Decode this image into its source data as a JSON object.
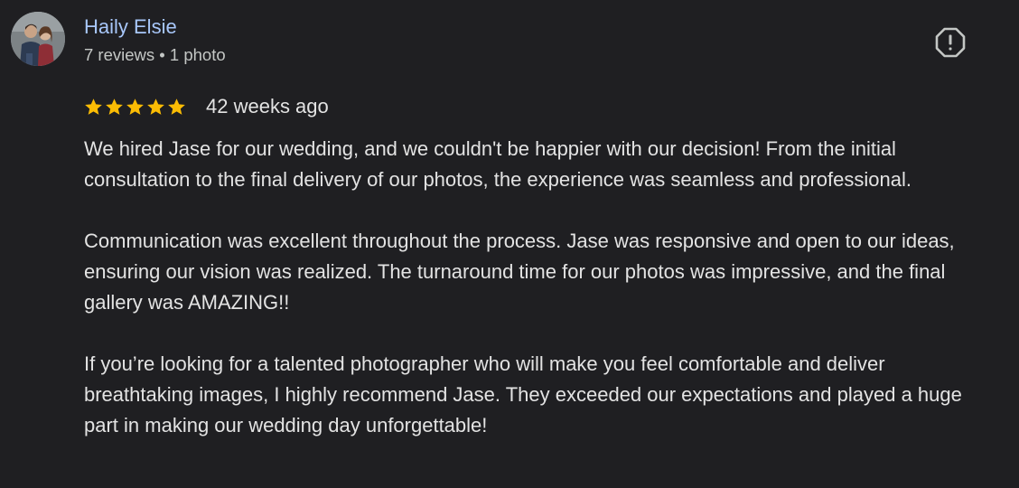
{
  "reviewer": {
    "name": "Haily Elsie",
    "meta": "7 reviews • 1 photo"
  },
  "report_icon": "report-flag-icon",
  "rating": {
    "stars": 5,
    "max_stars": 5,
    "date": "42 weeks ago",
    "star_color": "#fbbc04"
  },
  "review": {
    "paragraphs": [
      "We hired Jase for our wedding, and we couldn't be happier with our decision! From the initial consultation to the final delivery of our photos, the experience was seamless and professional.",
      "Communication was excellent throughout the process. Jase was responsive and open to our ideas, ensuring our vision was realized. The turnaround time for our photos was impressive, and the final gallery was AMAZING!!",
      "If you’re looking for a talented photographer who will make you feel comfortable and deliver breathtaking images, I highly recommend Jase. They exceeded our expectations and played a huge part in making our wedding day unforgettable!"
    ]
  },
  "colors": {
    "background": "#1f1f22",
    "name": "#a8c7fa",
    "text": "#e3e3e3",
    "meta": "#c4c7c5"
  }
}
